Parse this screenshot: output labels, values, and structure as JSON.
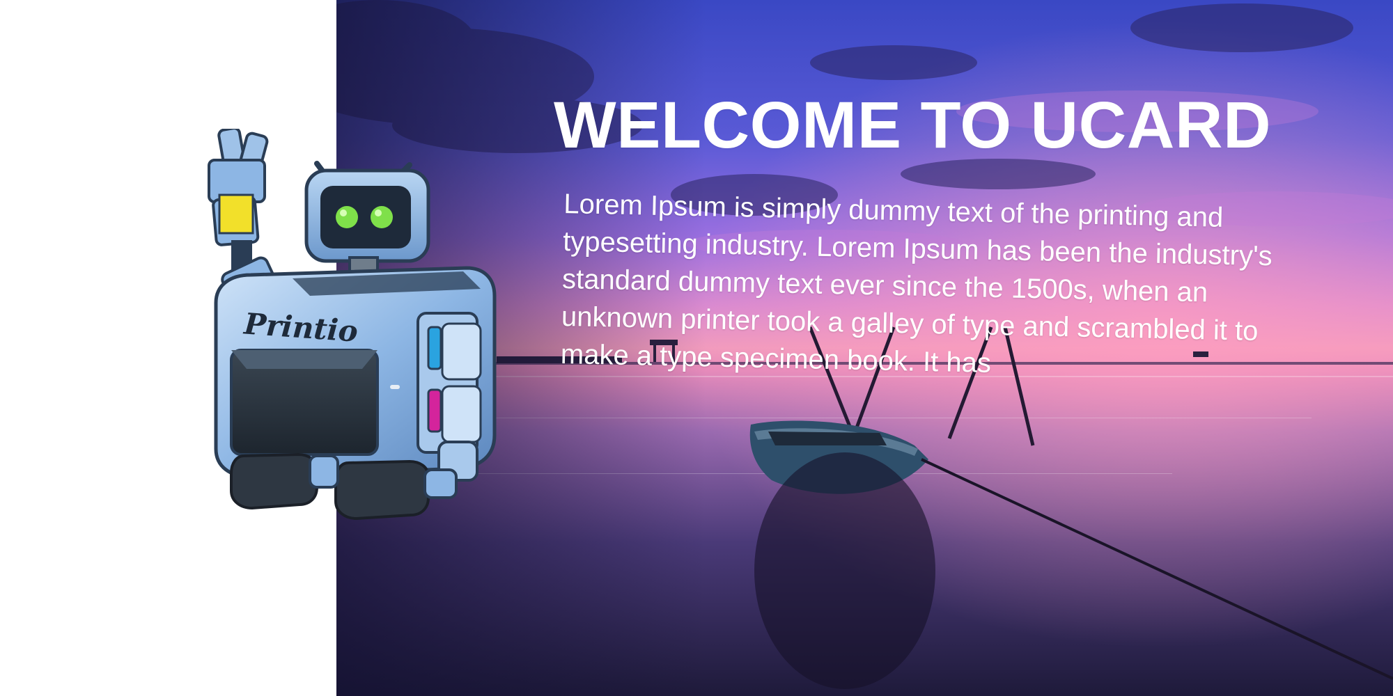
{
  "hero": {
    "title": "WELCOME TO UCARD",
    "body": "Lorem Ipsum is simply dummy text of the printing and typesetting industry. Lorem Ipsum has been the industry's standard dummy text ever since the 1500s, when an unknown printer took a galley of type and scrambled it to make a type specimen book. It has"
  },
  "mascot": {
    "logo_text": "Printio",
    "icon": "printer-robot-icon"
  },
  "colors": {
    "sky_top": "#3b4fc9",
    "sky_mid": "#a56fe0",
    "horizon": "#f08fb8",
    "water_dark": "#1e1a3a",
    "robot_body": "#8fb8e6",
    "robot_eyes": "#7fe04a",
    "ink_yellow": "#f2e02a"
  }
}
